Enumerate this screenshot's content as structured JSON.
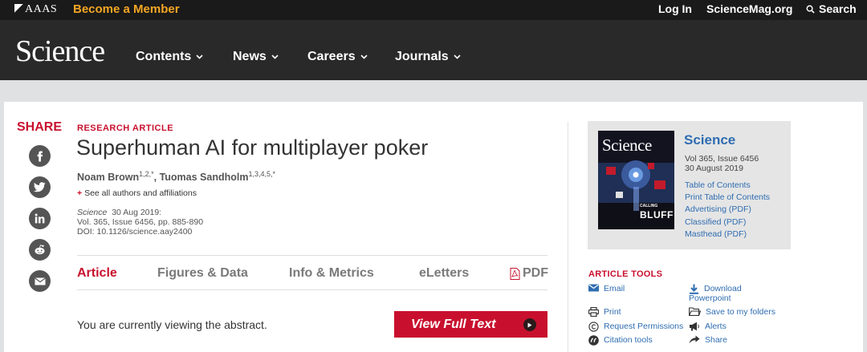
{
  "topbar": {
    "aaas_logo": "AAAS",
    "become_member": "Become a Member",
    "login": "Log In",
    "sciencemag": "ScienceMag.org",
    "search": "Search"
  },
  "navbar": {
    "logo": "Science",
    "items": [
      "Contents",
      "News",
      "Careers",
      "Journals"
    ]
  },
  "share": {
    "label": "SHARE",
    "icons": [
      "facebook-icon",
      "twitter-icon",
      "linkedin-icon",
      "reddit-icon",
      "email-icon"
    ]
  },
  "article": {
    "kicker": "RESEARCH ARTICLE",
    "title": "Superhuman AI for multiplayer poker",
    "authors": [
      {
        "name": "Noam Brown",
        "sup": "1,2,*"
      },
      {
        "name": "Tuomas Sandholm",
        "sup": "1,3,4,5,*"
      }
    ],
    "see_all": "See all authors and affiliations",
    "journal": "Science",
    "date": "30 Aug 2019:",
    "volume": "Vol. 365, Issue 6456, pp. 885-890",
    "doi": "DOI: 10.1126/science.aay2400"
  },
  "tabs": [
    "Article",
    "Figures & Data",
    "Info & Metrics",
    "eLetters",
    "PDF"
  ],
  "abstract_notice": "You are currently viewing the abstract.",
  "full_text_button": "View Full Text",
  "issue": {
    "journal": "Science",
    "cover_masthead": "Science",
    "cover_headline_1": "CALLING",
    "cover_headline_2": "BLUFF",
    "vol": "Vol 365, Issue 6456",
    "date": "30 August 2019",
    "links": [
      "Table of Contents",
      "Print Table of Contents",
      "Advertising (PDF)",
      "Classified (PDF)",
      "Masthead (PDF)"
    ]
  },
  "tools": {
    "heading": "ARTICLE TOOLS",
    "email": "Email",
    "download_1": "Download",
    "download_2": "Powerpoint",
    "print": "Print",
    "save": "Save to my folders",
    "permissions": "Request Permissions",
    "alerts": "Alerts",
    "citation": "Citation tools",
    "share": "Share"
  },
  "colors": {
    "accent_red": "#c8102e",
    "link_blue": "#2f6db1",
    "member_orange": "#f5a623",
    "nav_dark": "#292929"
  }
}
